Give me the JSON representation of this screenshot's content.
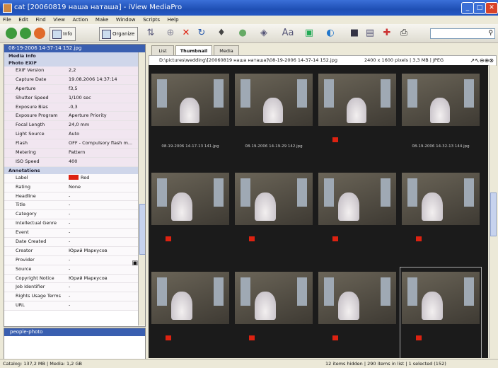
{
  "window": {
    "title": "cat [20060819 наша наташа] - iView MediaPro"
  },
  "menu": [
    "File",
    "Edit",
    "Find",
    "View",
    "Action",
    "Make",
    "Window",
    "Scripts",
    "Help"
  ],
  "toolbar": {
    "info_label": "Info",
    "organize_label": "Organize"
  },
  "left_panel": {
    "header": "08-19-2006 14-37-14 152.jpg",
    "media_info_label": "Media Info",
    "photo_exif_label": "Photo EXIF",
    "exif": [
      {
        "key": "EXIF Version",
        "value": "2,2"
      },
      {
        "key": "Capture Date",
        "value": "19.08.2006 14:37:14"
      },
      {
        "key": "Aperture",
        "value": "f3,5"
      },
      {
        "key": "Shutter Speed",
        "value": "1/100 sec"
      },
      {
        "key": "Exposure Bias",
        "value": "-0,3"
      },
      {
        "key": "Exposure Program",
        "value": "Aperture Priority"
      },
      {
        "key": "Focal Length",
        "value": "24,0 mm"
      },
      {
        "key": "Light Source",
        "value": "Auto"
      },
      {
        "key": "Flash",
        "value": "OFF - Compulsory flash m..."
      },
      {
        "key": "Metering",
        "value": "Pattern"
      },
      {
        "key": "ISO Speed",
        "value": "400"
      }
    ],
    "annotations_label": "Annotations",
    "annotations": [
      {
        "key": "Label",
        "value": "Red",
        "red": true
      },
      {
        "key": "Rating",
        "value": "None"
      },
      {
        "key": "Headline",
        "value": "-"
      },
      {
        "key": "Title",
        "value": "-"
      },
      {
        "key": "Category",
        "value": "-"
      },
      {
        "key": "Intellectual Genre",
        "value": "-"
      },
      {
        "key": "Event",
        "value": "-"
      },
      {
        "key": "Date Created",
        "value": "-"
      },
      {
        "key": "Creator",
        "value": "Юрий Маркусов"
      },
      {
        "key": "Provider",
        "value": "-"
      },
      {
        "key": "Source",
        "value": "-"
      },
      {
        "key": "Copyright Notice",
        "value": "Юрий Маркусов"
      },
      {
        "key": "Job Identifier",
        "value": "-"
      },
      {
        "key": "Rights Usage Terms",
        "value": "-"
      },
      {
        "key": "URL",
        "value": "-"
      }
    ],
    "lower_header": "people-photo"
  },
  "right_panel": {
    "tabs": [
      "List",
      "Thumbnail",
      "Media"
    ],
    "path": "D:\\pictures\\wedding\\[20060819 наша наташа]\\08-19-2006 14-37-14 152.jpg",
    "image_info": "2400 x 1600 pixels | 3,3 MB | JPEG",
    "thumbnails": [
      {
        "name": "08-19-2006 14-17-13 141.jpg",
        "red": false
      },
      {
        "name": "08-19-2006 14-19-29 142.jpg",
        "red": false
      },
      {
        "name": "",
        "red": true
      },
      {
        "name": "08-19-2006 14-32-13 144.jpg",
        "red": false
      },
      {
        "name": "",
        "red": true
      },
      {
        "name": "",
        "red": true
      },
      {
        "name": "",
        "red": true
      },
      {
        "name": "",
        "red": true
      },
      {
        "name": "",
        "red": true
      },
      {
        "name": "",
        "red": true
      },
      {
        "name": "",
        "red": true
      },
      {
        "name": "",
        "red": true
      }
    ]
  },
  "status": {
    "left": "Catalog: 137,2 MB | Media: 1,2 GB",
    "right": "12 items hidden | 290 items in list | 1 selected (152)"
  },
  "colors": {
    "accent": "#3a5fb0",
    "label_red": "#d21"
  }
}
